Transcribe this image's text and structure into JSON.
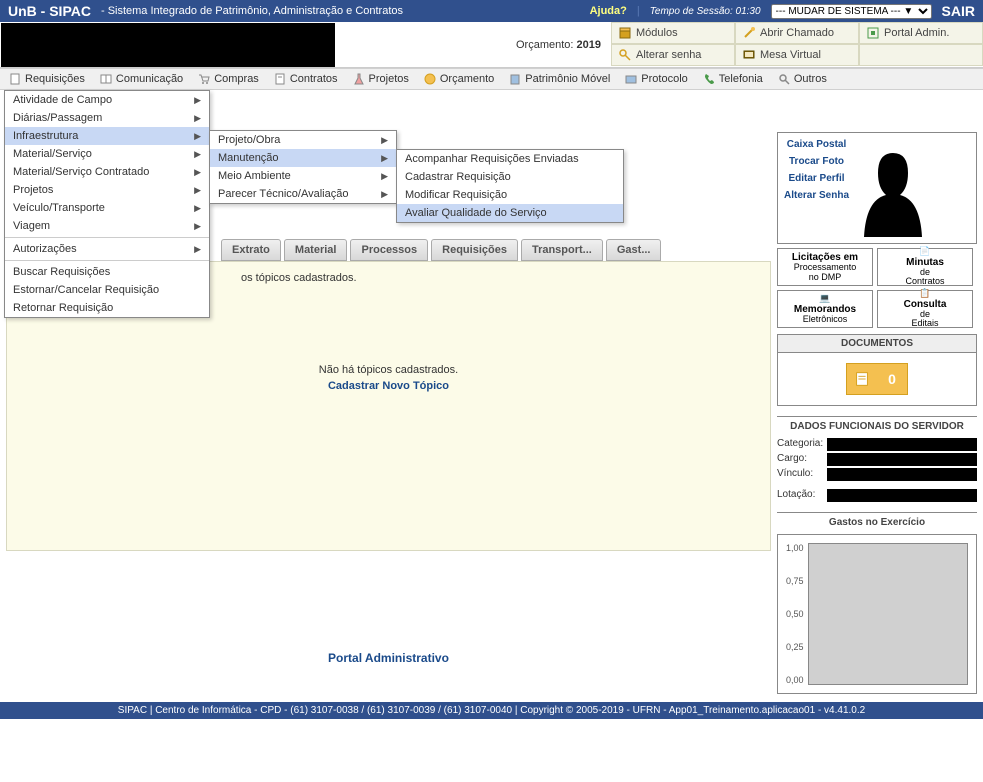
{
  "top_bar": {
    "brand": "UnB - SIPAC",
    "subtitle": "- Sistema Integrado de Patrimônio, Administração e Contratos",
    "ajuda": "Ajuda?",
    "tempo_label": "Tempo de Sessão:",
    "tempo_value": "01:30",
    "system_select": "--- MUDAR DE SISTEMA --- ▼",
    "sair": "SAIR"
  },
  "header": {
    "orcamento_label": "Orçamento:",
    "orcamento_year": "2019",
    "links": {
      "modulos": "Módulos",
      "abrir_chamado": "Abrir Chamado",
      "portal_admin": "Portal Admin.",
      "alterar_senha": "Alterar senha",
      "mesa_virtual": "Mesa Virtual"
    }
  },
  "toolbar": {
    "requisicoes": "Requisições",
    "comunicacao": "Comunicação",
    "compras": "Compras",
    "contratos": "Contratos",
    "projetos": "Projetos",
    "orcamento": "Orçamento",
    "patrimonio": "Patrimônio Móvel",
    "protocolo": "Protocolo",
    "telefonia": "Telefonia",
    "outros": "Outros"
  },
  "dropdown1": {
    "items": [
      "Atividade de Campo",
      "Diárias/Passagem",
      "Infraestrutura",
      "Material/Serviço",
      "Material/Serviço Contratado",
      "Projetos",
      "Veículo/Transporte",
      "Viagem",
      "Autorizações",
      "Buscar Requisições",
      "Estornar/Cancelar Requisição",
      "Retornar Requisição"
    ]
  },
  "dropdown2": {
    "items": [
      "Projeto/Obra",
      "Manutenção",
      "Meio Ambiente",
      "Parecer Técnico/Avaliação"
    ]
  },
  "dropdown3": {
    "items": [
      "Acompanhar Requisições Enviadas",
      "Cadastrar Requisição",
      "Modificar Requisição",
      "Avaliar Qualidade do Serviço"
    ]
  },
  "tabs": {
    "extrato": "Extrato",
    "material": "Material",
    "processos": "Processos",
    "requisicoes": "Requisições",
    "transport": "Transport...",
    "gast": "Gast..."
  },
  "content": {
    "partial_text": "os tópicos cadastrados.",
    "no_topics": "Não há tópicos cadastrados.",
    "cadastrar": "Cadastrar Novo Tópico",
    "portal": "Portal Administrativo"
  },
  "profile": {
    "caixa_postal": "Caixa Postal",
    "trocar_foto": "Trocar Foto",
    "editar_perfil": "Editar Perfil",
    "alterar_senha": "Alterar Senha"
  },
  "banners": {
    "b1_l1": "Licitações em",
    "b1_l2": "Processamento",
    "b1_l3": "no DMP",
    "b2_l1": "Minutas",
    "b2_l2": "de",
    "b2_l3": "Contratos",
    "b3_l1": "Memorandos",
    "b3_l2": "Eletrônicos",
    "b4_l1": "Consulta",
    "b4_l2": "de",
    "b4_l3": "Editais"
  },
  "documentos": {
    "header": "DOCUMENTOS",
    "count": "0"
  },
  "dados_funcionais": {
    "header": "DADOS FUNCIONAIS DO SERVIDOR",
    "categoria": "Categoria:",
    "cargo": "Cargo:",
    "vinculo": "Vínculo:",
    "lotacao": "Lotação:"
  },
  "gastos": {
    "header": "Gastos no Exercício"
  },
  "chart_data": {
    "type": "line",
    "title": "Gastos no Exercício",
    "ylabel": "",
    "ylim": [
      0,
      1.0
    ],
    "yticks": [
      "1,00",
      "0,75",
      "0,50",
      "0,25",
      "0,00"
    ],
    "categories": [],
    "values": []
  },
  "footer": {
    "text": "SIPAC | Centro de Informática - CPD - (61) 3107-0038 / (61) 3107-0039 / (61) 3107-0040 | Copyright © 2005-2019 - UFRN - App01_Treinamento.aplicacao01 - v4.41.0.2"
  }
}
